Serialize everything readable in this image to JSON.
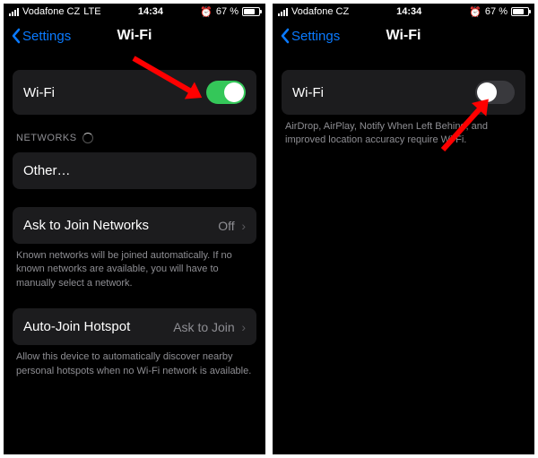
{
  "status": {
    "carrier": "Vodafone CZ",
    "network": "LTE",
    "time": "14:34",
    "alarm_glyph": "⏰",
    "battery": "67 %"
  },
  "nav": {
    "back_label": "Settings",
    "title": "Wi-Fi"
  },
  "left_screen": {
    "wifi_row_label": "Wi-Fi",
    "networks_header": "NETWORKS",
    "other_label": "Other…",
    "ask_join_label": "Ask to Join Networks",
    "ask_join_value": "Off",
    "ask_join_footer": "Known networks will be joined automatically. If no known networks are available, you will have to manually select a network.",
    "auto_hotspot_label": "Auto-Join Hotspot",
    "auto_hotspot_value": "Ask to Join",
    "auto_hotspot_footer": "Allow this device to automatically discover nearby personal hotspots when no Wi-Fi network is available."
  },
  "right_screen": {
    "wifi_row_label": "Wi-Fi",
    "off_footer": "AirDrop, AirPlay, Notify When Left Behind, and improved location accuracy require Wi-Fi."
  }
}
